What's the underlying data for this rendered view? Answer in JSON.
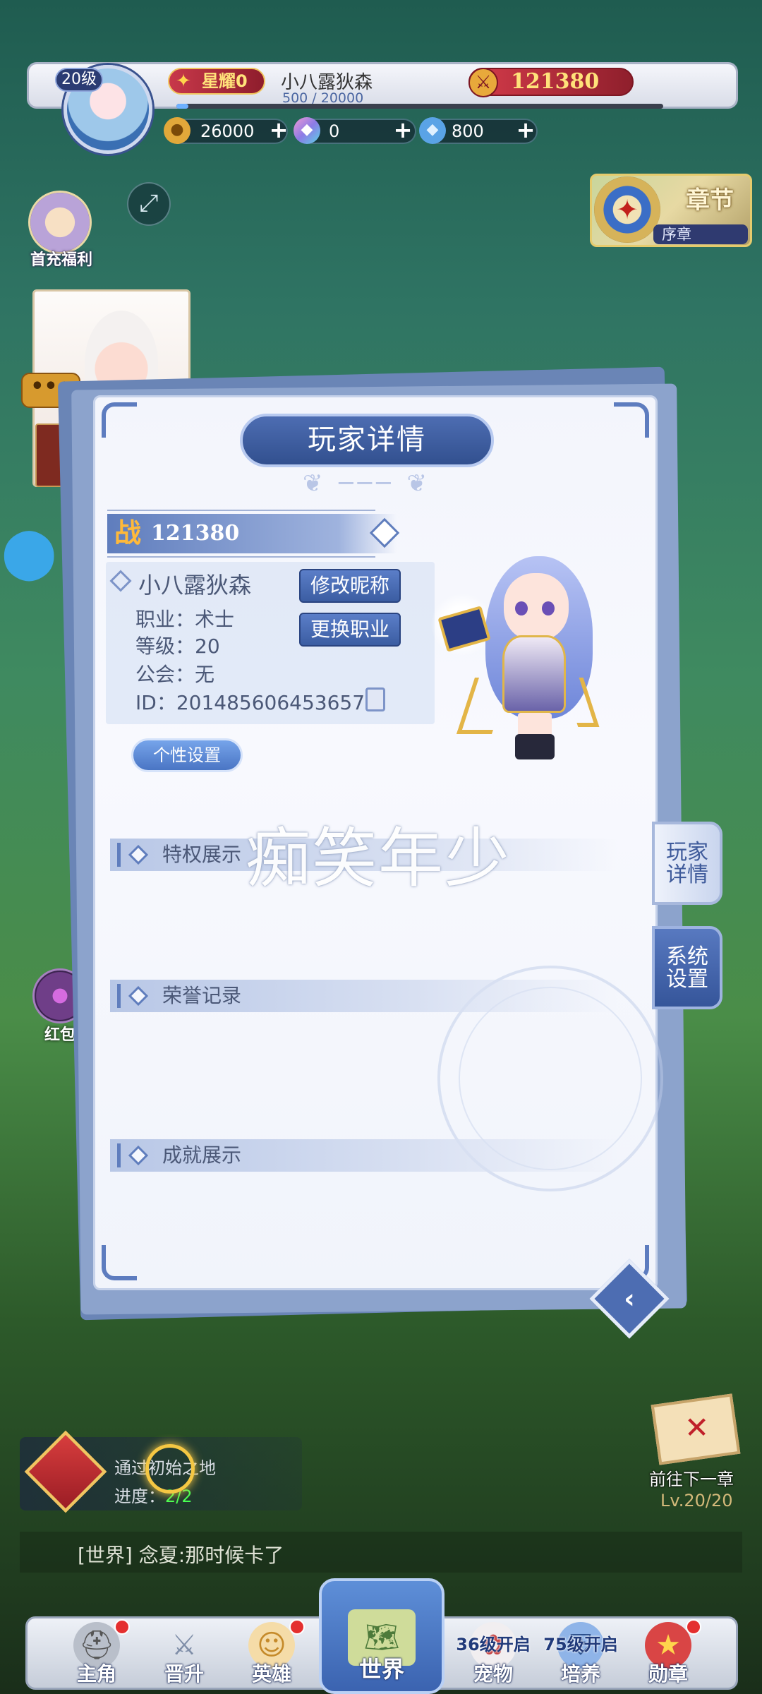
{
  "header": {
    "level": "20级",
    "honor": "星耀0",
    "player_name": "小八露狄森",
    "exp": "500 / 20000",
    "exp_fraction": 0.025,
    "power": "121380"
  },
  "resources": [
    {
      "value": "26000",
      "icon": "gold-coin-icon",
      "color": "#e2a83a"
    },
    {
      "value": "0",
      "icon": "rainbow-gem-icon",
      "color": "#c97be6"
    },
    {
      "value": "800",
      "icon": "crystal-icon",
      "color": "#5aa3e6"
    }
  ],
  "left_widgets": {
    "recharge_label": "首充福利",
    "red_packet_label": "红包"
  },
  "chapter": {
    "title": "章节",
    "subtitle": "序章"
  },
  "modal": {
    "title": "玩家详情",
    "power_badge": "战",
    "power_value": "121380",
    "name": "小八露狄森",
    "profession_label": "职业：",
    "profession": "术士",
    "level_label": "等级：",
    "level": "20",
    "guild_label": "公会：",
    "guild": "无",
    "id_label": "ID：",
    "id": "201485606453657",
    "rename_button": "修改昵称",
    "change_job_button": "更换职业",
    "custom_button": "个性设置",
    "sections": [
      "特权展示",
      "荣誉记录",
      "成就展示"
    ],
    "watermark": "痴笑年少",
    "tabs": [
      "玩家\n详情",
      "系统\n设置"
    ]
  },
  "quest": {
    "title": "通过初始之地",
    "progress_label": "进度：",
    "progress_value": "2/2"
  },
  "next_chapter": {
    "label": "前往下一章",
    "level": "Lv.20/20"
  },
  "chat": {
    "channel": "[世界]",
    "message": "念夏:那时候卡了"
  },
  "bottom_nav": [
    {
      "label": "主角",
      "icon": "knight-helmet-icon",
      "dot": true,
      "lock": ""
    },
    {
      "label": "晋升",
      "icon": "crossed-swords-icon",
      "dot": false,
      "lock": ""
    },
    {
      "label": "英雄",
      "icon": "hero-portrait-icon",
      "dot": true,
      "lock": ""
    },
    {
      "label": "世界",
      "icon": "world-map-icon",
      "dot": false,
      "lock": ""
    },
    {
      "label": "宠物",
      "icon": "fox-mask-icon",
      "dot": false,
      "lock": "36级开启"
    },
    {
      "label": "培养",
      "icon": "helmet-icon",
      "dot": false,
      "lock": "75级开启"
    },
    {
      "label": "勋章",
      "icon": "medal-shield-icon",
      "dot": true,
      "lock": ""
    }
  ]
}
